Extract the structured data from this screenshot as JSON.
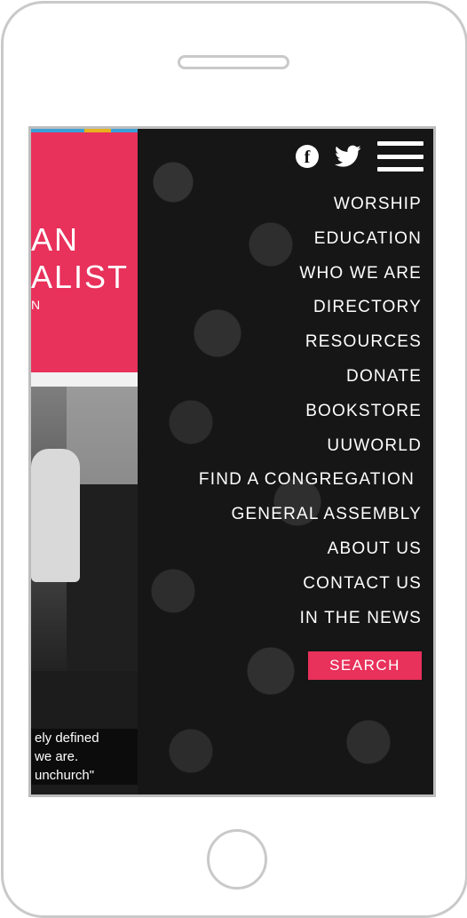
{
  "brand": {
    "line1": "AN",
    "line2": "ALIST",
    "line3": "N"
  },
  "peek_text": [
    "ely defined",
    "we are.",
    "unchurch\""
  ],
  "social": {
    "facebook_icon": "facebook-icon",
    "twitter_icon": "twitter-icon",
    "menu_icon": "hamburger-menu-icon"
  },
  "menu": {
    "items": [
      {
        "label": "WORSHIP"
      },
      {
        "label": "EDUCATION"
      },
      {
        "label": "WHO WE ARE"
      },
      {
        "label": "DIRECTORY"
      },
      {
        "label": "RESOURCES"
      },
      {
        "label": "DONATE"
      },
      {
        "label": "BOOKSTORE"
      },
      {
        "label": "UUWORLD"
      },
      {
        "label": "FIND A CONGREGATION"
      },
      {
        "label": "GENERAL ASSEMBLY"
      },
      {
        "label": "ABOUT US"
      },
      {
        "label": "CONTACT US"
      },
      {
        "label": "IN THE NEWS"
      }
    ],
    "search_label": "SEARCH"
  },
  "colors": {
    "accent": "#e8315b",
    "menu_bg": "#161616",
    "text": "#ffffff"
  }
}
